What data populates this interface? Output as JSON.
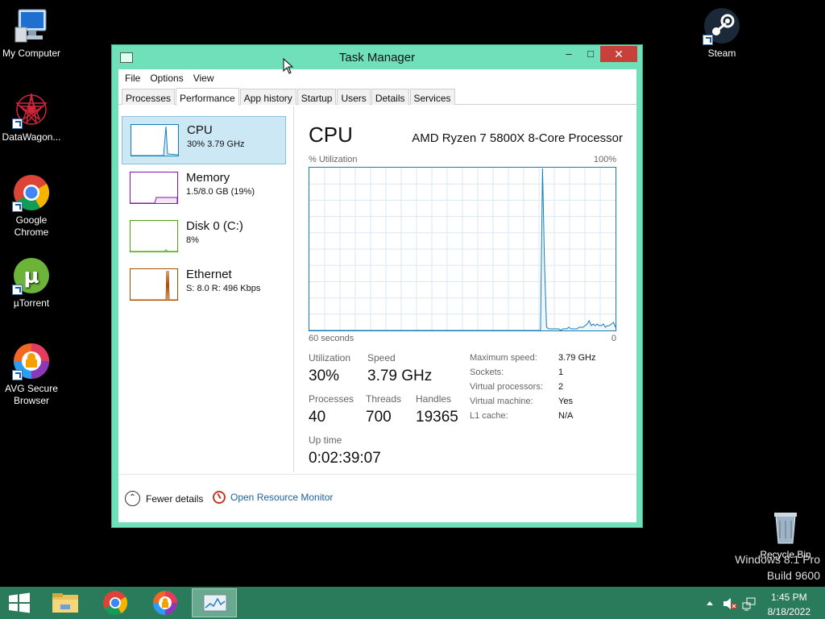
{
  "desktop": {
    "icons_left": [
      {
        "label": "My Computer"
      },
      {
        "label": "DataWagon..."
      },
      {
        "label": "Google Chrome"
      },
      {
        "label": "µTorrent"
      },
      {
        "label": "AVG Secure Browser"
      }
    ],
    "icons_right": [
      {
        "label": "Steam"
      },
      {
        "label": "Recycle Bin"
      }
    ],
    "watermark": {
      "line1": "Windows 8.1 Pro",
      "line2": "Build 9600"
    }
  },
  "window": {
    "title": "Task Manager",
    "menu": [
      "File",
      "Options",
      "View"
    ],
    "tabs": [
      "Processes",
      "Performance",
      "App history",
      "Startup",
      "Users",
      "Details",
      "Services"
    ],
    "active_tab": "Performance",
    "resources": [
      {
        "name": "CPU",
        "value": "30% 3.79 GHz",
        "color": "#117dbb",
        "selected": true
      },
      {
        "name": "Memory",
        "value": "1.5/8.0 GB (19%)",
        "color": "#8b12ae",
        "selected": false
      },
      {
        "name": "Disk 0 (C:)",
        "value": "8%",
        "color": "#4da60c",
        "selected": false
      },
      {
        "name": "Ethernet",
        "value": "S: 8.0  R: 496 Kbps",
        "color": "#a74f01",
        "selected": false
      }
    ],
    "detail": {
      "title": "CPU",
      "model": "AMD Ryzen 7 5800X 8-Core Processor",
      "graph_label_left": "% Utilization",
      "graph_label_right": "100%",
      "graph_bottom_left": "60 seconds",
      "graph_bottom_right": "0",
      "stats": {
        "utilization_label": "Utilization",
        "utilization": "30%",
        "speed_label": "Speed",
        "speed": "3.79 GHz",
        "processes_label": "Processes",
        "processes": "40",
        "threads_label": "Threads",
        "threads": "700",
        "handles_label": "Handles",
        "handles": "19365",
        "uptime_label": "Up time",
        "uptime": "0:02:39:07"
      },
      "specs": [
        {
          "label": "Maximum speed:",
          "value": "3.79 GHz"
        },
        {
          "label": "Sockets:",
          "value": "1"
        },
        {
          "label": "Virtual processors:",
          "value": "2"
        },
        {
          "label": "Virtual machine:",
          "value": "Yes"
        },
        {
          "label": "L1 cache:",
          "value": "N/A"
        }
      ]
    },
    "footer": {
      "fewer_details": "Fewer details",
      "open_resource_monitor": "Open Resource Monitor"
    }
  },
  "cpu_history": [
    0,
    0,
    0,
    0,
    0,
    0,
    0,
    0,
    0,
    0,
    0,
    0,
    0,
    0,
    0,
    0,
    0,
    0,
    0,
    0,
    0,
    0,
    0,
    0,
    0,
    0,
    0,
    0,
    0,
    0,
    0,
    0,
    0,
    0,
    0,
    0,
    0,
    0,
    0,
    0,
    0,
    0,
    0,
    0,
    0,
    0,
    0,
    0,
    0,
    0,
    0,
    0,
    0,
    0,
    0,
    0,
    0,
    0,
    0,
    0,
    0,
    0,
    0,
    0,
    0,
    0,
    0,
    0,
    0,
    0,
    0,
    0,
    0,
    0,
    0,
    0,
    0,
    0,
    0,
    0,
    0,
    0,
    0,
    0,
    0,
    0,
    0,
    0,
    0,
    0,
    0,
    0,
    0,
    0,
    0,
    0,
    0,
    0,
    0,
    0,
    0,
    0,
    0,
    0,
    0,
    0,
    0,
    0,
    0,
    0,
    0,
    0,
    0,
    0,
    0,
    100,
    40,
    2,
    1,
    1,
    1,
    1,
    1,
    1,
    0,
    1,
    1,
    1,
    2,
    1,
    1,
    1,
    1,
    2,
    2,
    2,
    3,
    4,
    6,
    3,
    4,
    3,
    4,
    3,
    3,
    4,
    2,
    3,
    3,
    4,
    5,
    2
  ],
  "taskbar": {
    "time": "1:45 PM",
    "date": "8/18/2022",
    "items": [
      "file-explorer",
      "google-chrome",
      "avg-secure-browser",
      "task-manager"
    ]
  }
}
